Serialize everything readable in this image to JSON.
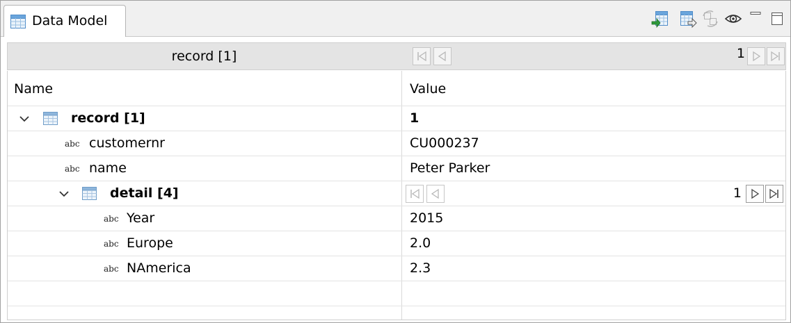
{
  "view": {
    "tab_label": "Data Model",
    "toolbar_icons": [
      "import-data-icon",
      "export-data-icon",
      "synchronize-icon",
      "show-hide-icon",
      "minimize-icon",
      "maximize-icon"
    ]
  },
  "record_nav": {
    "title": "record [1]",
    "current": "1"
  },
  "table": {
    "headers": {
      "name": "Name",
      "value": "Value"
    },
    "rows": [
      {
        "name": "record [1]",
        "value": "1",
        "type": "table",
        "expanded": true
      },
      {
        "name": "customernr",
        "value": "CU000237",
        "type": "abc"
      },
      {
        "name": "name",
        "value": "Peter Parker",
        "type": "abc"
      },
      {
        "name": "detail [4]",
        "value": "",
        "type": "table",
        "expanded": true,
        "nav_current": "1"
      },
      {
        "name": "Year",
        "value": "2015",
        "type": "abc"
      },
      {
        "name": "Europe",
        "value": "2.0",
        "type": "abc"
      },
      {
        "name": "NAmerica",
        "value": "2.3",
        "type": "abc"
      }
    ],
    "abc_label": "abc"
  }
}
